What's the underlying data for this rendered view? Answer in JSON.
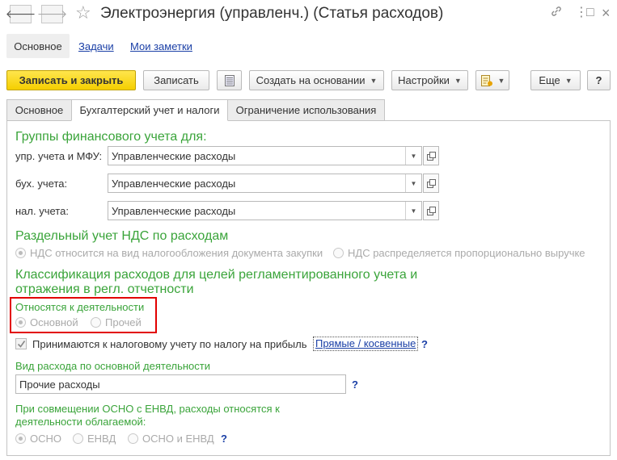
{
  "window": {
    "title": "Электроэнергия (управленч.) (Статья расходов)",
    "icons": [
      "back-arrow-icon",
      "forward-arrow-icon",
      "star-icon",
      "link-icon",
      "more-icon",
      "maximize-icon",
      "close-icon"
    ]
  },
  "nav": {
    "back": "🡐",
    "forward": "🡒",
    "star": "☆",
    "link": "🔗",
    "more": "⋮",
    "maximize": "□",
    "close": "×"
  },
  "sections": {
    "main": "Основное",
    "tasks": "Задачи",
    "notes": "Мои заметки"
  },
  "toolbar": {
    "save_close": "Записать и закрыть",
    "save": "Записать",
    "create_based": "Создать на основании",
    "settings": "Настройки",
    "more": "Еще",
    "help": "?"
  },
  "tabs": [
    {
      "label": "Основное"
    },
    {
      "label": "Бухгалтерский учет и налоги"
    },
    {
      "label": "Ограничение использования"
    }
  ],
  "finance_groups": {
    "heading": "Группы финансового учета для:",
    "rows": [
      {
        "label": "упр. учета и МФУ:",
        "value": "Управленческие расходы"
      },
      {
        "label": "бух. учета:",
        "value": "Управленческие расходы"
      },
      {
        "label": "нал. учета:",
        "value": "Управленческие расходы"
      }
    ]
  },
  "vat": {
    "heading": "Раздельный учет НДС по расходам",
    "option1": "НДС относится на вид налогообложения документа закупки",
    "option2": "НДС распределяется пропорционально выручке",
    "selected": "option1"
  },
  "classification": {
    "heading_line1": "Классификация расходов для целей регламентированного учета и",
    "heading_line2": "отражения в регл. отчетности",
    "activity_label": "Относятся к деятельности",
    "activity_option1": "Основной",
    "activity_option2": "Прочей",
    "activity_selected": "option1",
    "tax_checkbox_label": "Принимаются к налоговому учету по налогу на прибыль",
    "tax_checked": true,
    "direct_indirect_link": "Прямые / косвенные",
    "help": "?",
    "expense_type_label": "Вид расхода по основной деятельности",
    "expense_type_value": "Прочие расходы",
    "combo_label_line1": "При совмещении ОСНО с ЕНВД, расходы относятся к",
    "combo_label_line2": "деятельности облагаемой:",
    "combo_option1": "ОСНО",
    "combo_option2": "ЕНВД",
    "combo_option3": "ОСНО и ЕНВД",
    "combo_selected": "option1"
  },
  "colors": {
    "primary_button": "#f5cf00",
    "heading_green": "#3aa43a",
    "link_blue": "#1a3fa6",
    "highlight_red": "#e20000"
  }
}
